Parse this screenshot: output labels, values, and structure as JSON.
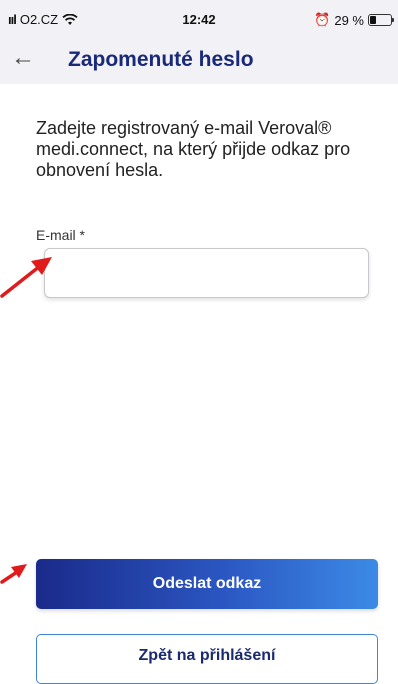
{
  "status_bar": {
    "carrier": "O2.CZ",
    "time": "12:42",
    "battery_text": "29 %",
    "battery_level": 0.29,
    "icons": [
      "signal-icon",
      "wifi-icon",
      "alarm-icon",
      "battery-icon"
    ]
  },
  "header": {
    "back_icon": "arrow-left-icon",
    "title": "Zapomenuté heslo"
  },
  "intro_text": "Zadejte registrovaný e-mail Veroval® medi.connect, na který přijde odkaz pro obnovení hesla.",
  "email": {
    "label": "E-mail *",
    "value": ""
  },
  "buttons": {
    "send_label": "Odeslat odkaz",
    "back_to_login_label": "Zpět na přihlášení"
  },
  "colors": {
    "title": "#1a2a78",
    "arrow": "#e01b1b",
    "button_gradient_start": "#1a2a8a",
    "button_gradient_end": "#3c8ae6",
    "outline_border": "#3f85d6"
  }
}
